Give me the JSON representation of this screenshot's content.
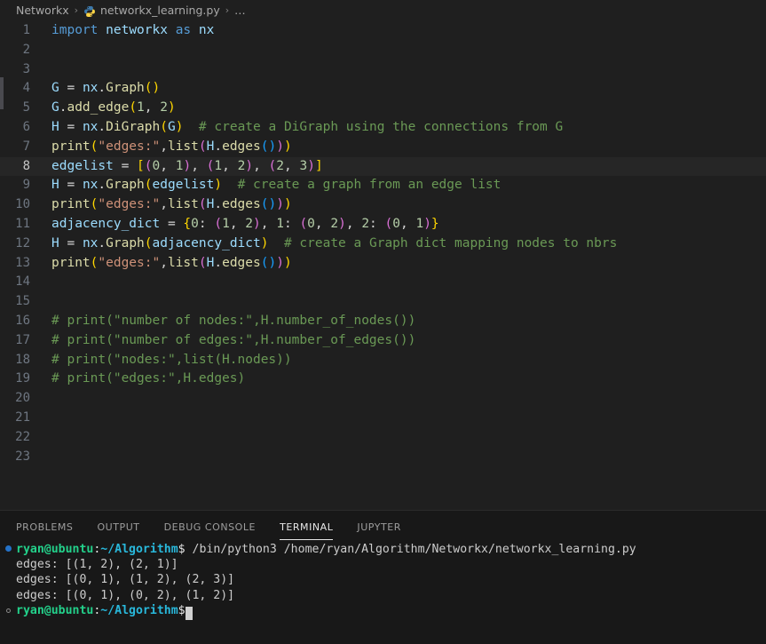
{
  "breadcrumb": {
    "root": "Networkx",
    "sep": "›",
    "file": "networkx_learning.py",
    "file_icon": "python-file-icon",
    "ellipsis": "…"
  },
  "editor": {
    "language": "python",
    "current_line": 8,
    "total_lines": 23,
    "line_numbers": [
      "1",
      "2",
      "3",
      "4",
      "5",
      "6",
      "7",
      "8",
      "9",
      "10",
      "11",
      "12",
      "13",
      "14",
      "15",
      "16",
      "17",
      "18",
      "19",
      "20",
      "21",
      "22",
      "23"
    ],
    "lines": [
      "import networkx as nx",
      "",
      "",
      "G = nx.Graph()",
      "G.add_edge(1, 2)",
      "H = nx.DiGraph(G)  # create a DiGraph using the connections from G",
      "print(\"edges:\",list(H.edges()))",
      "edgelist = [(0, 1), (1, 2), (2, 3)]",
      "H = nx.Graph(edgelist)  # create a graph from an edge list",
      "print(\"edges:\",list(H.edges()))",
      "adjacency_dict = {0: (1, 2), 1: (0, 2), 2: (0, 1)}",
      "H = nx.Graph(adjacency_dict)  # create a Graph dict mapping nodes to nbrs",
      "print(\"edges:\",list(H.edges()))",
      "",
      "",
      "# print(\"number of nodes:\",H.number_of_nodes())",
      "# print(\"number of edges:\",H.number_of_edges())",
      "# print(\"nodes:\",list(H.nodes))",
      "# print(\"edges:\",H.edges)",
      "",
      "",
      "",
      ""
    ]
  },
  "panel": {
    "tabs": [
      {
        "label": "PROBLEMS",
        "active": false
      },
      {
        "label": "OUTPUT",
        "active": false
      },
      {
        "label": "DEBUG CONSOLE",
        "active": false
      },
      {
        "label": "TERMINAL",
        "active": true
      },
      {
        "label": "JUPYTER",
        "active": false
      }
    ]
  },
  "terminal": {
    "prompt_user": "ryan@ubuntu",
    "prompt_colon": ":",
    "prompt_path": "~/Algorithm",
    "prompt_dollar": "$",
    "command": " /bin/python3 /home/ryan/Algorithm/Networkx/networkx_learning.py",
    "output": [
      "edges: [(1, 2), (2, 1)]",
      "edges: [(0, 1), (1, 2), (2, 3)]",
      "edges: [(0, 1), (0, 2), (1, 2)]"
    ],
    "trailing_input": ""
  },
  "colors": {
    "editor_bg": "#1f1f1f",
    "panel_bg": "#181818",
    "current_line_bg": "#262626",
    "keyword": "#569cd6",
    "function": "#dcdcaa",
    "string": "#ce9178",
    "number": "#b5cea8",
    "comment": "#6a9955",
    "variable": "#9cdcfe",
    "bracket_yellow": "#ffd700",
    "bracket_pink": "#da70d6",
    "bracket_blue": "#179fff",
    "terminal_green": "#23d18b",
    "terminal_cyan": "#29b8db",
    "success_dot": "#2472c8"
  }
}
